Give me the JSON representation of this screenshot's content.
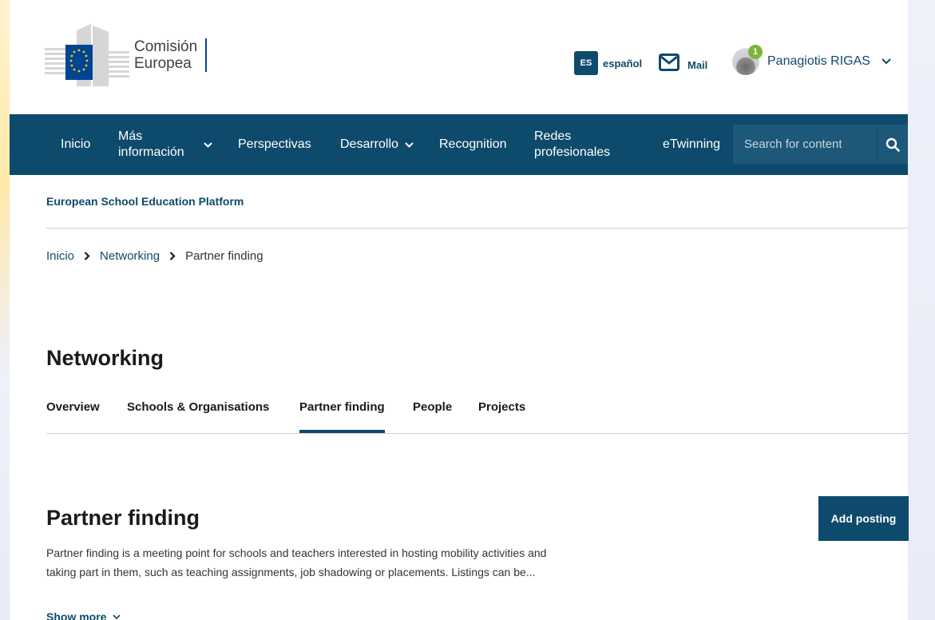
{
  "header": {
    "logo_text_line1": "Comisión",
    "logo_text_line2": "Europea",
    "language_code": "ES",
    "language_label": "español",
    "mail_label": "Mail",
    "user_name": "Panagiotis RIGAS",
    "notification_count": "1"
  },
  "nav": {
    "items": [
      {
        "label": "Inicio"
      },
      {
        "label_line1": "Más",
        "label_line2": "información"
      },
      {
        "label": "Perspectivas"
      },
      {
        "label": "Desarrollo"
      },
      {
        "label": "Recognition"
      },
      {
        "label_line1": "Redes",
        "label_line2": "profesionales"
      },
      {
        "label": "eTwinning"
      }
    ],
    "search_placeholder": "Search for content"
  },
  "platform_title": "European School Education Platform",
  "breadcrumb": [
    "Inicio",
    "Networking",
    "Partner finding"
  ],
  "section_title": "Networking",
  "tabs": [
    "Overview",
    "Schools & Organisations",
    "Partner finding",
    "People",
    "Projects"
  ],
  "active_tab": "Partner finding",
  "content": {
    "title": "Partner finding",
    "add_button": "Add posting",
    "description_line1": "Partner finding is a meeting point for schools and teachers interested in hosting mobility activities and",
    "description_line2": "taking part in them, such as teaching assignments, job shadowing or placements. Listings can be...",
    "show_more": "Show more"
  },
  "colors": {
    "primary": "#0e4a6b",
    "eu_blue": "#004494",
    "eu_yellow": "#ffcc00",
    "badge_green": "#7fb33b"
  }
}
